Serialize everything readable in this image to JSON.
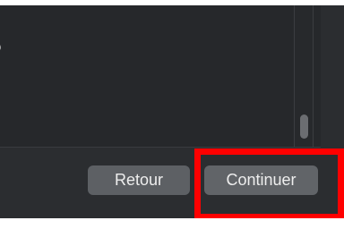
{
  "content": {
    "partial_text": "o"
  },
  "footer": {
    "back_label": "Retour",
    "continue_label": "Continuer"
  },
  "annotation": {
    "highlight_color": "#ff0000"
  }
}
